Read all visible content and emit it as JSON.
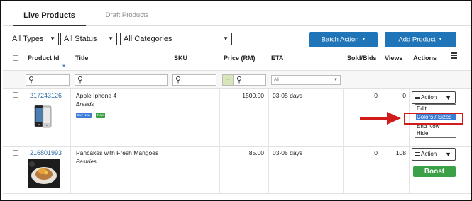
{
  "tabs": [
    {
      "label": "Live Products",
      "active": true
    },
    {
      "label": "Draft Products",
      "active": false
    }
  ],
  "filters": {
    "types": "All Types",
    "status": "All Status",
    "categories": "All Categories"
  },
  "buttons": {
    "batch_action": "Batch Action",
    "add_product": "Add Product"
  },
  "columns": [
    "Product Id",
    "Title",
    "SKU",
    "Price (RM)",
    "ETA",
    "Sold/Bids",
    "Views",
    "Actions"
  ],
  "filter_row": {
    "price_operator": "=",
    "eta_placeholder": "All"
  },
  "products": [
    {
      "id": "217243126",
      "title": "Apple Iphone 4",
      "category": "Breads",
      "tags": [
        "Buy Now",
        "New"
      ],
      "price": "1500.00",
      "eta": "03-05 days",
      "sold": "0",
      "views": "0",
      "action_label": "Action"
    },
    {
      "id": "216801993",
      "title": "Pancakes with Fresh Mangoes",
      "category": "Pastries",
      "price": "85.00",
      "eta": "03-05 days",
      "sold": "0",
      "views": "108",
      "action_label": "Action",
      "boost_label": "Boost"
    }
  ],
  "action_menu": [
    "Edit",
    "Colors / Sizes",
    "End Now",
    "Hide"
  ],
  "action_menu_selected": "Colors / Sizes",
  "colors": {
    "primary_button": "#1f75b8",
    "link": "#2e6da4",
    "tag_buy_now": "#3a7cd6",
    "tag_new": "#3aa147",
    "boost": "#3aa147",
    "annotation": "#d21b1b"
  }
}
